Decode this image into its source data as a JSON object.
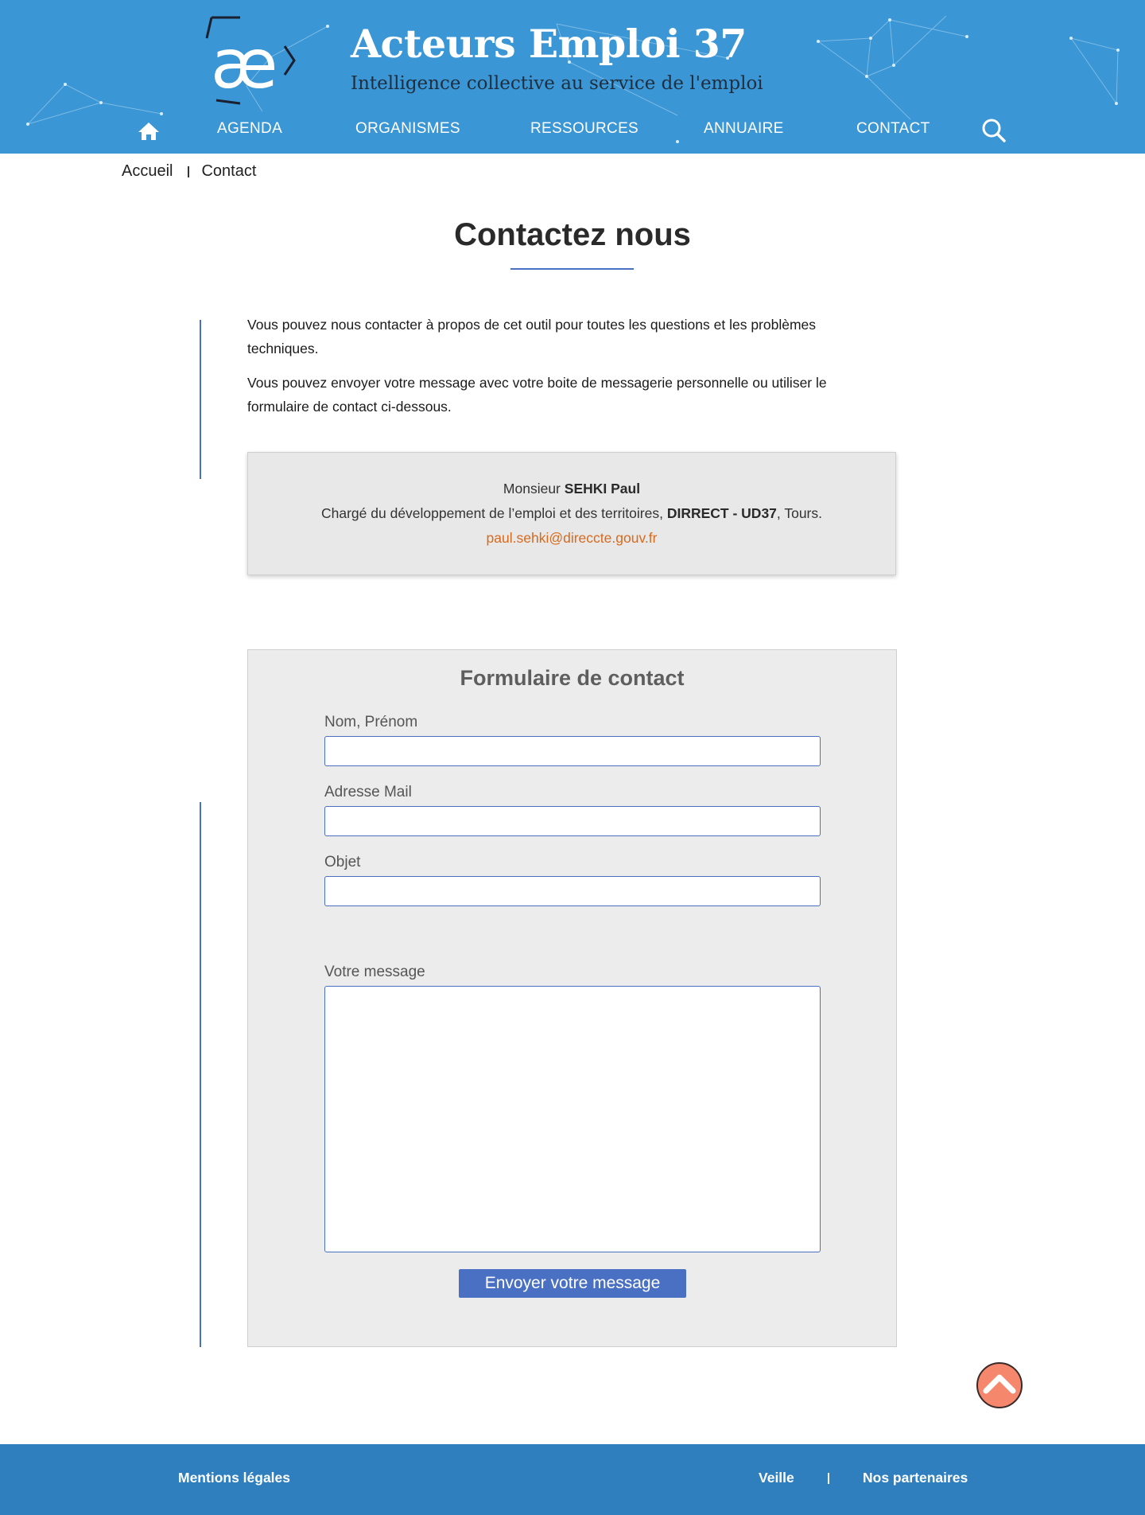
{
  "header": {
    "title": "Acteurs Emploi 37",
    "tagline": "Intelligence collective au service de l'emploi",
    "logo_icon": "ae-ligature-logo",
    "background_color": "#3a96d4"
  },
  "nav": {
    "home_icon": "home-icon",
    "items": [
      "AGENDA",
      "ORGANISMES",
      "RESSOURCES",
      "ANNUAIRE",
      "CONTACT"
    ],
    "search_icon": "search-icon"
  },
  "breadcrumb": {
    "home": "Accueil",
    "current": "Contact"
  },
  "page": {
    "title": "Contactez nous",
    "intro_1": "Vous pouvez nous contacter à propos de cet outil pour toutes les questions et les problèmes techniques.",
    "intro_2": "Vous pouvez envoyer votre message avec votre boite de messagerie personnelle ou utiliser le formulaire de contact ci-dessous."
  },
  "contact_card": {
    "civility": "Monsieur",
    "name": "SEHKI Paul",
    "role": "Chargé du développement de l’emploi et des territoires,",
    "org": "DIRRECT - UD37",
    "city": ", Tours.",
    "email": "paul.sehki@direccte.gouv.fr",
    "email_color": "#d86a1e"
  },
  "form": {
    "title": "Formulaire de contact",
    "name_label": "Nom, Prénom",
    "name_value": "",
    "email_label": "Adresse Mail",
    "email_value": "",
    "subject_label": "Objet",
    "subject_value": "",
    "message_label": "Votre message",
    "message_value": "",
    "submit_label": "Envoyer votre message",
    "accent_color": "#4a70c4"
  },
  "back_to_top": {
    "icon": "chevron-up-icon",
    "color": "#f5876c"
  },
  "footer": {
    "legal": "Mentions légales",
    "watch": "Veille",
    "partners": "Nos partenaires",
    "background_color": "#2f7fbf"
  }
}
